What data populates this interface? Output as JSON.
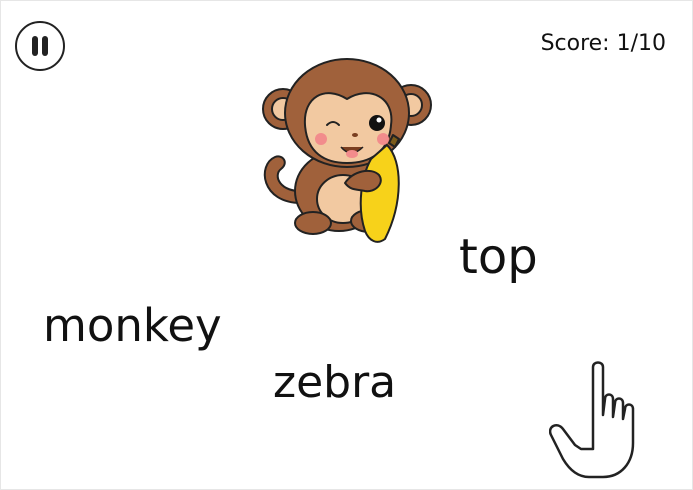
{
  "hud": {
    "score_label": "Score:",
    "score_value": "1/10",
    "pause_icon": "pause-icon"
  },
  "picture": {
    "icon": "monkey-with-banana"
  },
  "words": {
    "top": "top",
    "monkey": "monkey",
    "zebra": "zebra"
  },
  "hint": {
    "icon": "pointing-hand-icon"
  },
  "colors": {
    "monkey_brown": "#a0613b",
    "monkey_face": "#f2c9a1",
    "banana_yellow": "#f7d21a",
    "cheek_pink": "#f28c8c",
    "text": "#111111"
  }
}
